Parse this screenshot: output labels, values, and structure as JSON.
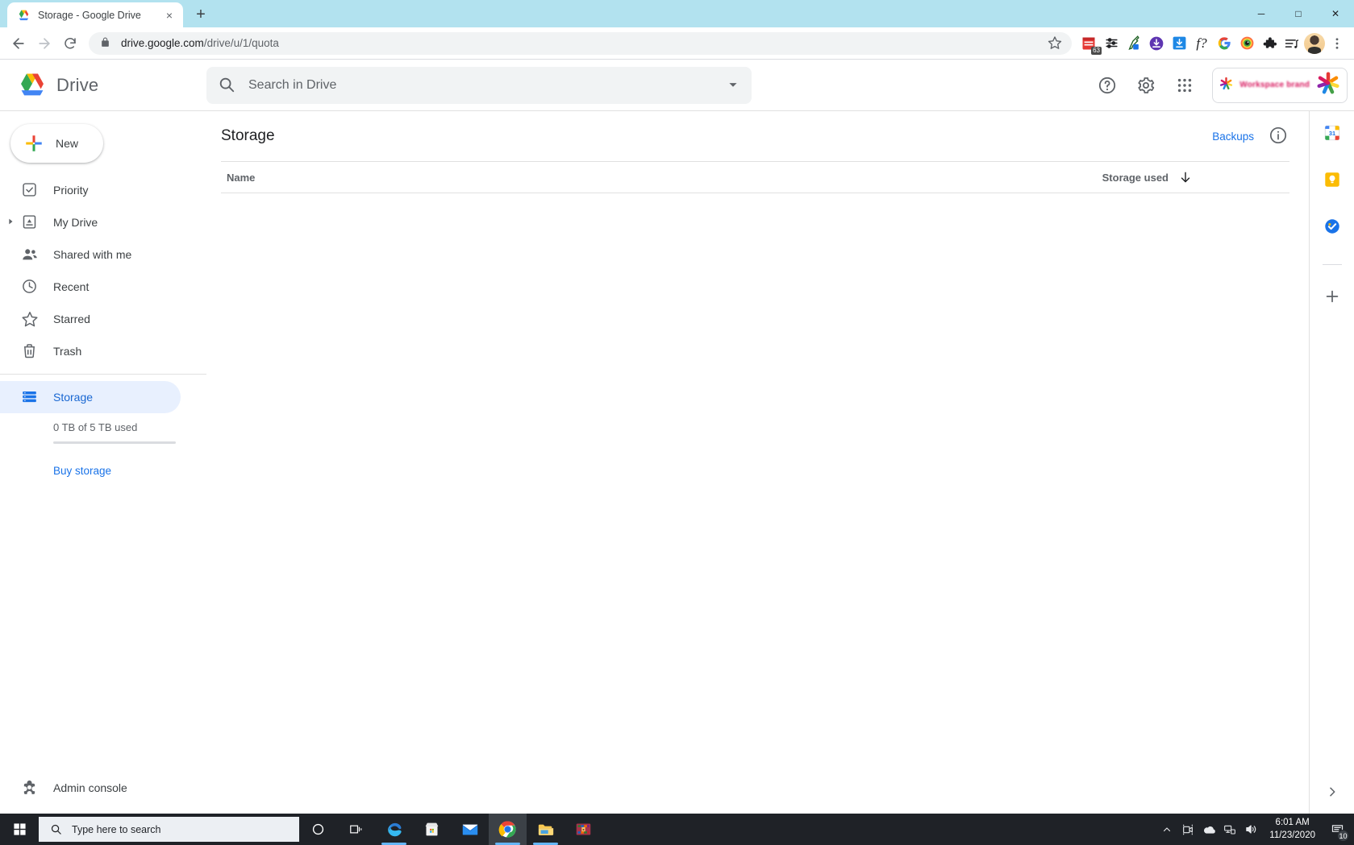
{
  "browser": {
    "tab": {
      "title": "Storage - Google Drive",
      "favicon": "drive-icon",
      "close": "×"
    },
    "new_tab_label": "+",
    "window_controls": {
      "minimize": "─",
      "maximize": "□",
      "close": "✕"
    },
    "nav": {
      "back": "←",
      "forward": "→",
      "reload": "⟳"
    },
    "omnibox": {
      "url_prefix": "drive.google.com",
      "url_path": "/drive/u/1/quota",
      "full_url": "drive.google.com/drive/u/1/quota",
      "lock_icon": "lock-icon",
      "star_icon": "bookmark-star-icon"
    },
    "extensions": [
      {
        "name": "calendar-extension-icon",
        "badge": "63"
      },
      {
        "name": "sliders-extension-icon",
        "badge": ""
      },
      {
        "name": "eyedropper-extension-icon",
        "badge": ""
      },
      {
        "name": "download-extension-icon",
        "badge": ""
      },
      {
        "name": "blue-download-extension-icon",
        "badge": ""
      },
      {
        "name": "font-finder-extension-icon",
        "badge": "f?"
      },
      {
        "name": "google-c-extension-icon",
        "badge": ""
      },
      {
        "name": "colorful-eye-extension-icon",
        "badge": ""
      },
      {
        "name": "puzzle-extensions-icon",
        "badge": ""
      },
      {
        "name": "music-playlist-icon",
        "badge": ""
      }
    ],
    "profile_avatar": "user-avatar",
    "menu_icon": "three-dot-menu-icon"
  },
  "drive": {
    "logo": "google-drive-logo",
    "wordmark": "Drive",
    "search": {
      "placeholder": "Search in Drive",
      "value": "",
      "icon": "search-icon",
      "options_icon": "search-options-chevron-icon"
    },
    "header_actions": [
      {
        "name": "help-icon",
        "glyph": "?"
      },
      {
        "name": "settings-gear-icon",
        "glyph": "⚙"
      },
      {
        "name": "google-apps-grid-icon",
        "glyph": "⋮⋮⋮"
      }
    ],
    "brand_chip": {
      "text": "Workspace brand",
      "icon": "colorful-star-logo"
    }
  },
  "sidebar": {
    "new_button": {
      "label": "New",
      "icon": "plus-icon"
    },
    "items": [
      {
        "label": "Priority",
        "icon": "priority-check-icon",
        "active": false,
        "expandable": false
      },
      {
        "label": "My Drive",
        "icon": "my-drive-icon",
        "active": false,
        "expandable": true
      },
      {
        "label": "Shared with me",
        "icon": "shared-people-icon",
        "active": false,
        "expandable": false
      },
      {
        "label": "Recent",
        "icon": "clock-icon",
        "active": false,
        "expandable": false
      },
      {
        "label": "Starred",
        "icon": "star-icon",
        "active": false,
        "expandable": false
      },
      {
        "label": "Trash",
        "icon": "trash-icon",
        "active": false,
        "expandable": false
      }
    ],
    "storage_item": {
      "label": "Storage",
      "icon": "storage-bars-icon",
      "active": true
    },
    "quota_text": "0 TB of 5 TB used",
    "quota_percent": 0,
    "buy_storage_label": "Buy storage",
    "admin_console": {
      "label": "Admin console",
      "icon": "admin-gear-icon"
    }
  },
  "main": {
    "title": "Storage",
    "backups_label": "Backups",
    "info_icon": "info-circle-icon",
    "table": {
      "columns": [
        {
          "label": "Name",
          "sorted": false
        },
        {
          "label": "Storage used",
          "sorted": true,
          "sort_direction": "descending",
          "sort_icon": "arrow-down-icon"
        }
      ],
      "rows": []
    }
  },
  "side_panel": {
    "items": [
      {
        "name": "google-calendar-icon",
        "day": "31"
      },
      {
        "name": "google-keep-icon",
        "day": ""
      },
      {
        "name": "google-tasks-icon",
        "day": ""
      }
    ],
    "add_label": "+",
    "expand_icon": "›"
  },
  "taskbar": {
    "start_icon": "windows-start-icon",
    "search": {
      "placeholder": "Type here to search",
      "icon": "search-icon"
    },
    "items": [
      {
        "name": "cortana-icon",
        "running": false,
        "active": false
      },
      {
        "name": "task-view-icon",
        "running": false,
        "active": false
      },
      {
        "name": "microsoft-edge-icon",
        "running": true,
        "active": false
      },
      {
        "name": "microsoft-store-icon",
        "running": false,
        "active": false
      },
      {
        "name": "mail-icon",
        "running": false,
        "active": false
      },
      {
        "name": "google-chrome-icon",
        "running": true,
        "active": true
      },
      {
        "name": "file-explorer-icon",
        "running": true,
        "active": false
      },
      {
        "name": "winrar-icon",
        "running": false,
        "active": false
      }
    ],
    "tray": [
      {
        "name": "show-hidden-icons-chevron"
      },
      {
        "name": "meet-camera-icon"
      },
      {
        "name": "onedrive-cloud-icon"
      },
      {
        "name": "network-icon"
      },
      {
        "name": "volume-icon"
      }
    ],
    "clock": {
      "time": "6:01 AM",
      "date": "11/23/2020"
    },
    "notifications": {
      "icon": "action-center-icon",
      "count": "10"
    }
  },
  "colors": {
    "accent_blue": "#1a73e8",
    "active_pill": "#e8f0fe",
    "tabstrip": "#b2e2ef",
    "taskbar": "#1f2227"
  }
}
